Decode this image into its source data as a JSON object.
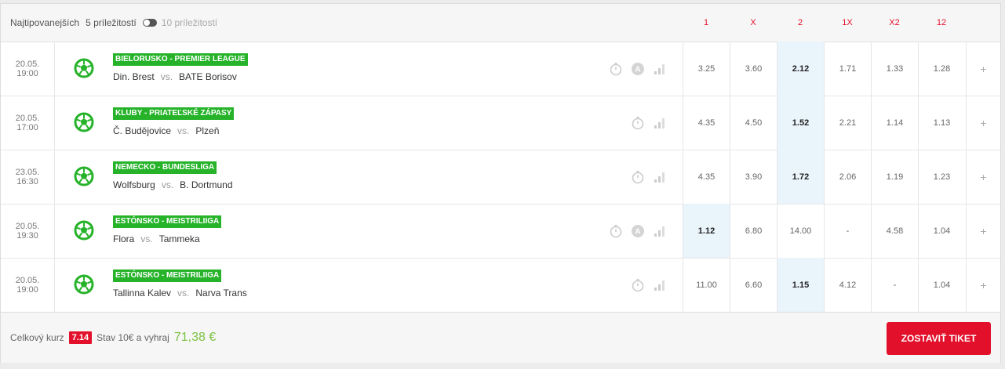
{
  "header": {
    "title": "Najtipovanejších",
    "option_5": "5 príležitostí",
    "option_10": "10 príležitostí",
    "columns": [
      "1",
      "X",
      "2",
      "1X",
      "X2",
      "12"
    ]
  },
  "colors": {
    "accent": "#e3102c",
    "league": "#26b32a",
    "selected_odd": "#eaf4fb",
    "win": "#7cc242"
  },
  "matches": [
    {
      "date": "20.05.",
      "time": "19:00",
      "league": "BIELORUSKO - PREMIER LEAGUE",
      "home": "Din. Brest",
      "vs": "vs.",
      "away": "BATE Borisov",
      "live_badge": true,
      "odds": [
        "3.25",
        "3.60",
        "2.12",
        "1.71",
        "1.33",
        "1.28"
      ],
      "selected": 2
    },
    {
      "date": "20.05.",
      "time": "17:00",
      "league": "KLUBY - PRIATEĽSKÉ ZÁPASY",
      "home": "Č. Budějovice",
      "vs": "vs.",
      "away": "Plzeň",
      "live_badge": false,
      "odds": [
        "4.35",
        "4.50",
        "1.52",
        "2.21",
        "1.14",
        "1.13"
      ],
      "selected": 2
    },
    {
      "date": "23.05.",
      "time": "16:30",
      "league": "NEMECKO - BUNDESLIGA",
      "home": "Wolfsburg",
      "vs": "vs.",
      "away": "B. Dortmund",
      "live_badge": false,
      "odds": [
        "4.35",
        "3.90",
        "1.72",
        "2.06",
        "1.19",
        "1.23"
      ],
      "selected": 2
    },
    {
      "date": "20.05.",
      "time": "19:30",
      "league": "ESTÓNSKO - MEISTRILIIGA",
      "home": "Flora",
      "vs": "vs.",
      "away": "Tammeka",
      "live_badge": true,
      "odds": [
        "1.12",
        "6.80",
        "14.00",
        "-",
        "4.58",
        "1.04"
      ],
      "selected": 0
    },
    {
      "date": "20.05.",
      "time": "19:00",
      "league": "ESTÓNSKO - MEISTRILIIGA",
      "home": "Tallinna Kalev",
      "vs": "vs.",
      "away": "Narva Trans",
      "live_badge": false,
      "odds": [
        "11.00",
        "6.60",
        "1.15",
        "4.12",
        "-",
        "1.04"
      ],
      "selected": 2
    }
  ],
  "row_plus": "+",
  "footer": {
    "total_label": "Celkový kurz",
    "total_odds": "7.14",
    "stake_text": "Stav 10€ a vyhraj",
    "win_amount": "71,38 €",
    "button_label": "ZOSTAVIŤ TIKET"
  }
}
